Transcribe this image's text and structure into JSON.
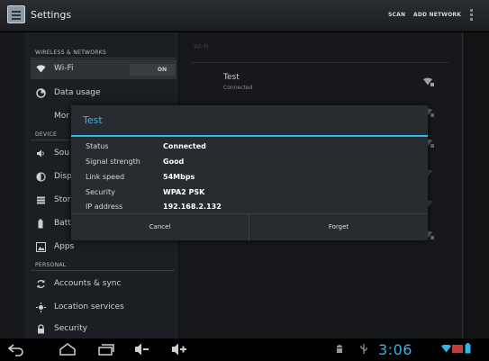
{
  "actionbar": {
    "title": "Settings",
    "scan_label": "SCAN",
    "add_network_label": "ADD NETWORK"
  },
  "sidebar": {
    "sections": {
      "wireless": "WIRELESS & NETWORKS",
      "device": "DEVICE",
      "personal": "PERSONAL"
    },
    "items": [
      {
        "label": "Wi-Fi",
        "icon": "wifi-icon",
        "toggle": "ON"
      },
      {
        "label": "Data usage",
        "icon": "data-usage-icon"
      },
      {
        "label": "Mor",
        "icon": ""
      },
      {
        "label": "Sou",
        "icon": "sound-icon"
      },
      {
        "label": "Disp",
        "icon": "display-icon"
      },
      {
        "label": "Stor",
        "icon": "storage-icon"
      },
      {
        "label": "Batt",
        "icon": "battery-icon"
      },
      {
        "label": "Apps",
        "icon": "apps-icon"
      },
      {
        "label": "Accounts & sync",
        "icon": "sync-icon"
      },
      {
        "label": "Location services",
        "icon": "location-icon"
      },
      {
        "label": "Security",
        "icon": "lock-icon"
      }
    ]
  },
  "wifi_panel": {
    "header": "Wi-Fi",
    "networks": [
      {
        "name": "Test",
        "status": "Connected"
      }
    ]
  },
  "dialog": {
    "title": "Test",
    "rows": [
      {
        "key": "Status",
        "value": "Connected"
      },
      {
        "key": "Signal strength",
        "value": "Good"
      },
      {
        "key": "Link speed",
        "value": "54Mbps"
      },
      {
        "key": "Security",
        "value": "WPA2 PSK"
      },
      {
        "key": "IP address",
        "value": "192.168.2.132"
      }
    ],
    "cancel_label": "Cancel",
    "forget_label": "Forget"
  },
  "systembar": {
    "clock": "3:06"
  },
  "colors": {
    "accent": "#33b5e5",
    "background": "#16181b"
  }
}
